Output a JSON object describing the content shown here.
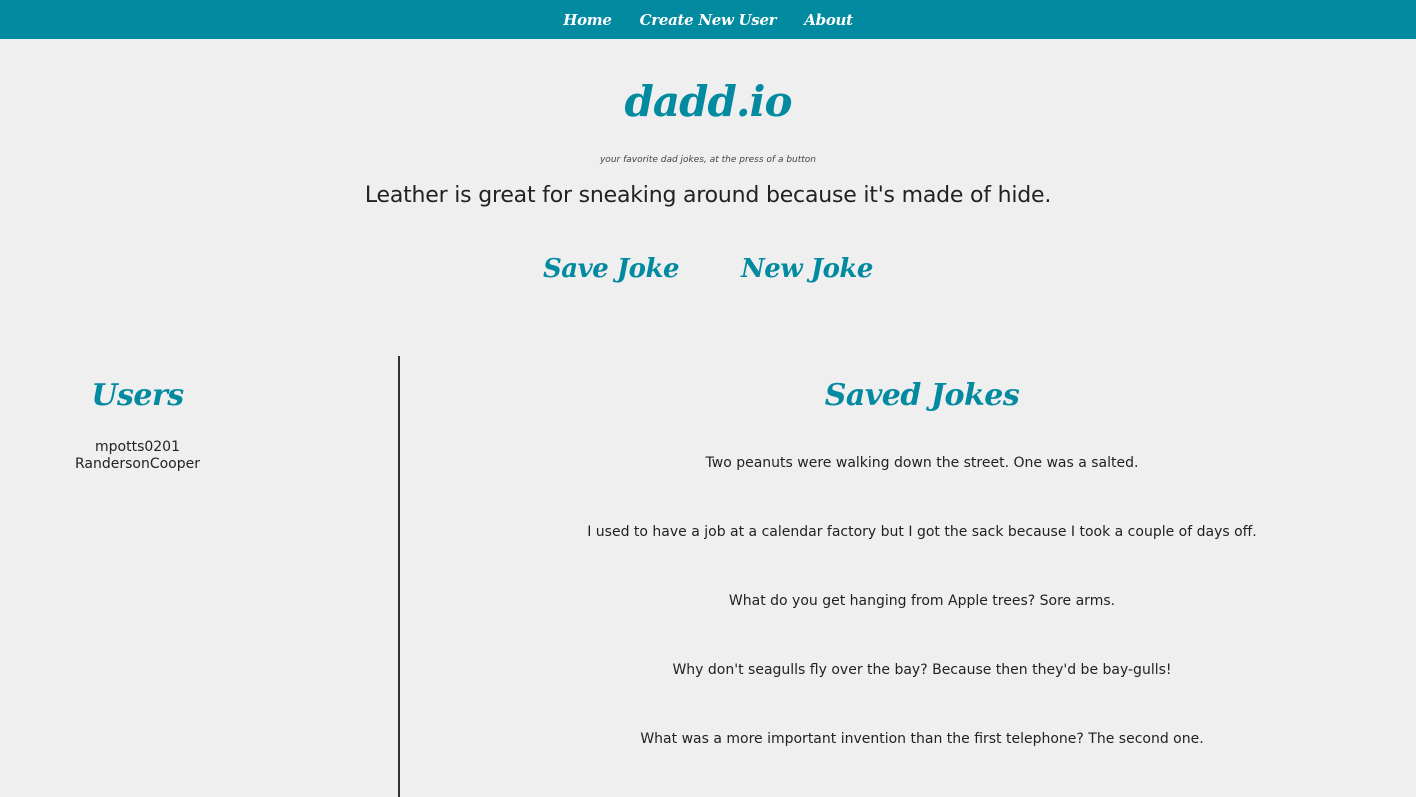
{
  "nav": {
    "items": [
      {
        "label": "Home"
      },
      {
        "label": "Create New User"
      },
      {
        "label": "About"
      }
    ]
  },
  "header": {
    "title": "dadd.io",
    "tagline": "your favorite dad jokes, at the press of a button"
  },
  "current_joke": "Leather is great for sneaking around because it's made of hide.",
  "actions": {
    "save_label": "Save Joke",
    "new_label": "New Joke"
  },
  "users": {
    "heading": "Users",
    "items": [
      "mpotts0201",
      "RandersonCooper"
    ]
  },
  "saved_jokes": {
    "heading": "Saved Jokes",
    "items": [
      "Two peanuts were walking down the street. One was a salted.",
      "I used to have a job at a calendar factory but I got the sack because I took a couple of days off.",
      "What do you get hanging from Apple trees? Sore arms.",
      "Why don't seagulls fly over the bay? Because then they'd be bay-gulls!",
      "What was a more important invention than the first telephone? The second one."
    ]
  },
  "colors": {
    "accent": "#028aa0",
    "background": "#efefef"
  }
}
